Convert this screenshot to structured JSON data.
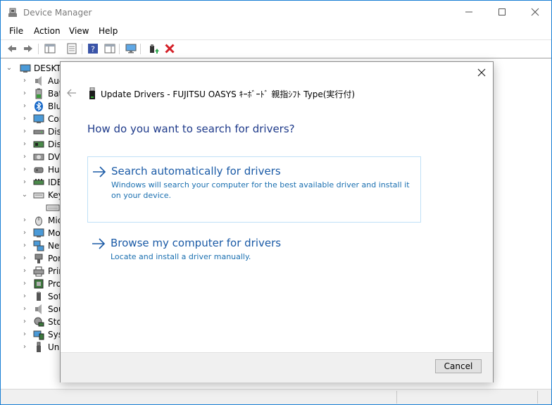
{
  "window": {
    "title": "Device Manager",
    "minimize_glyph": "─",
    "maximize_glyph": "☐",
    "close_glyph": "✕"
  },
  "menu": [
    {
      "label": "File"
    },
    {
      "label": "Action"
    },
    {
      "label": "View"
    },
    {
      "label": "Help"
    }
  ],
  "tree": {
    "root": "DESKTO",
    "items": [
      {
        "label": "Auc",
        "icon": "audio-icon"
      },
      {
        "label": "Bat",
        "icon": "battery-icon"
      },
      {
        "label": "Blu",
        "icon": "bluetooth-icon"
      },
      {
        "label": "Cor",
        "icon": "computer-icon"
      },
      {
        "label": "Disl",
        "icon": "disk-drive-icon"
      },
      {
        "label": "Disp",
        "icon": "display-adapter-icon"
      },
      {
        "label": "DVD",
        "icon": "dvd-drive-icon"
      },
      {
        "label": "Hur",
        "icon": "hid-icon"
      },
      {
        "label": "IDE",
        "icon": "ide-controller-icon"
      },
      {
        "label": "Key",
        "icon": "keyboard-icon"
      },
      {
        "label": "",
        "icon": "keyboard-device-icon"
      },
      {
        "label": "Mic",
        "icon": "mice-icon"
      },
      {
        "label": "Mo",
        "icon": "monitor-icon"
      },
      {
        "label": "Net",
        "icon": "network-adapter-icon"
      },
      {
        "label": "Por",
        "icon": "ports-icon"
      },
      {
        "label": "Prir",
        "icon": "print-queue-icon"
      },
      {
        "label": "Pro",
        "icon": "processor-icon"
      },
      {
        "label": "Sof",
        "icon": "software-device-icon"
      },
      {
        "label": "Sou",
        "icon": "sound-icon"
      },
      {
        "label": "Sto",
        "icon": "storage-controller-icon"
      },
      {
        "label": "Sys",
        "icon": "system-device-icon"
      },
      {
        "label": "Uni",
        "icon": "usb-controller-icon"
      }
    ]
  },
  "dialog": {
    "close_glyph": "✕",
    "title": "Update Drivers - FUJITSU OASYS ｷｰﾎﾞｰﾄﾞ 親指ｼﾌﾄ Type(実行付)",
    "question": "How do you want to search for drivers?",
    "options": [
      {
        "title": "Search automatically for drivers",
        "description": "Windows will search your computer for the best available driver and install it on your device."
      },
      {
        "title": "Browse my computer for drivers",
        "description": "Locate and install a driver manually."
      }
    ],
    "cancel_label": "Cancel"
  }
}
